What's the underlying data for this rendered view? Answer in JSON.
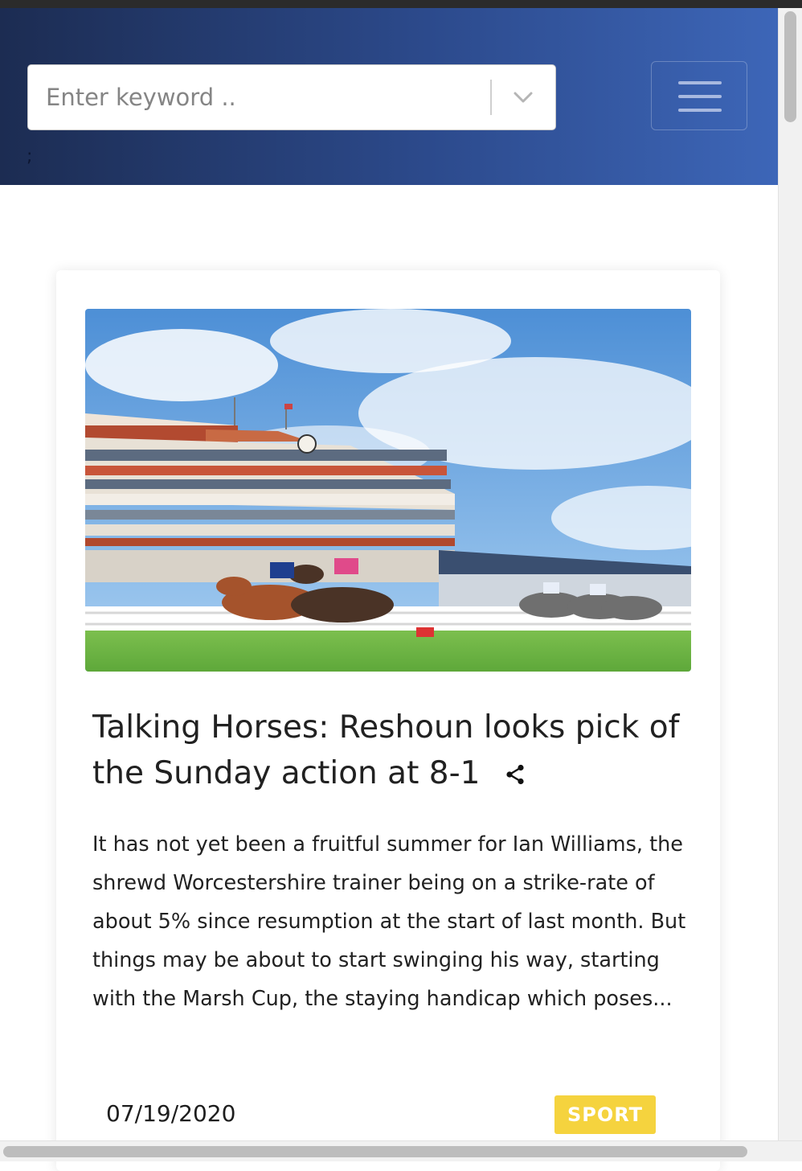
{
  "search": {
    "placeholder": "Enter keyword ..",
    "value": ""
  },
  "header": {
    "stray_text": ";"
  },
  "icons": {
    "search_dropdown": "chevron-down-icon",
    "menu": "hamburger-icon",
    "share": "share-icon"
  },
  "article": {
    "title": "Talking Horses: Reshoun looks pick of the Sunday action at 8-1",
    "excerpt": "It has not yet been a fruitful summer for Ian Williams, the shrewd Worcestershire trainer being on a strike-rate of about 5% since resumption at the start of last month. But things may be about to start swinging his way, starting with the Marsh Cup, the staying handicap which poses...",
    "date": "07/19/2020",
    "category": "SPORT"
  },
  "colors": {
    "header_gradient_start": "#1c2c52",
    "header_gradient_end": "#3d66b8",
    "category_badge": "#f5d33e"
  }
}
